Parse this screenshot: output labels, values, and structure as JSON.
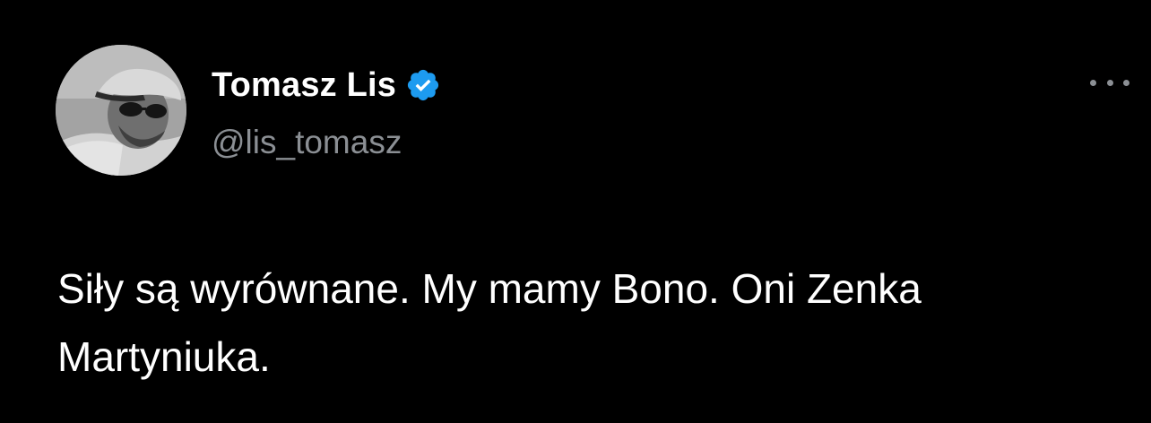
{
  "tweet": {
    "author": {
      "display_name": "Tomasz Lis",
      "handle": "@lis_tomasz",
      "verified": true,
      "verified_badge_color": "#1d9bf0"
    },
    "more_icon": "more-horizontal-icon",
    "text": "Siły są wyrównane. My mamy Bono. Oni Zenka Martyniuka."
  },
  "colors": {
    "background": "#000000",
    "primary_text": "#ffffff",
    "secondary_text": "#8b8f94",
    "accent": "#1d9bf0"
  }
}
